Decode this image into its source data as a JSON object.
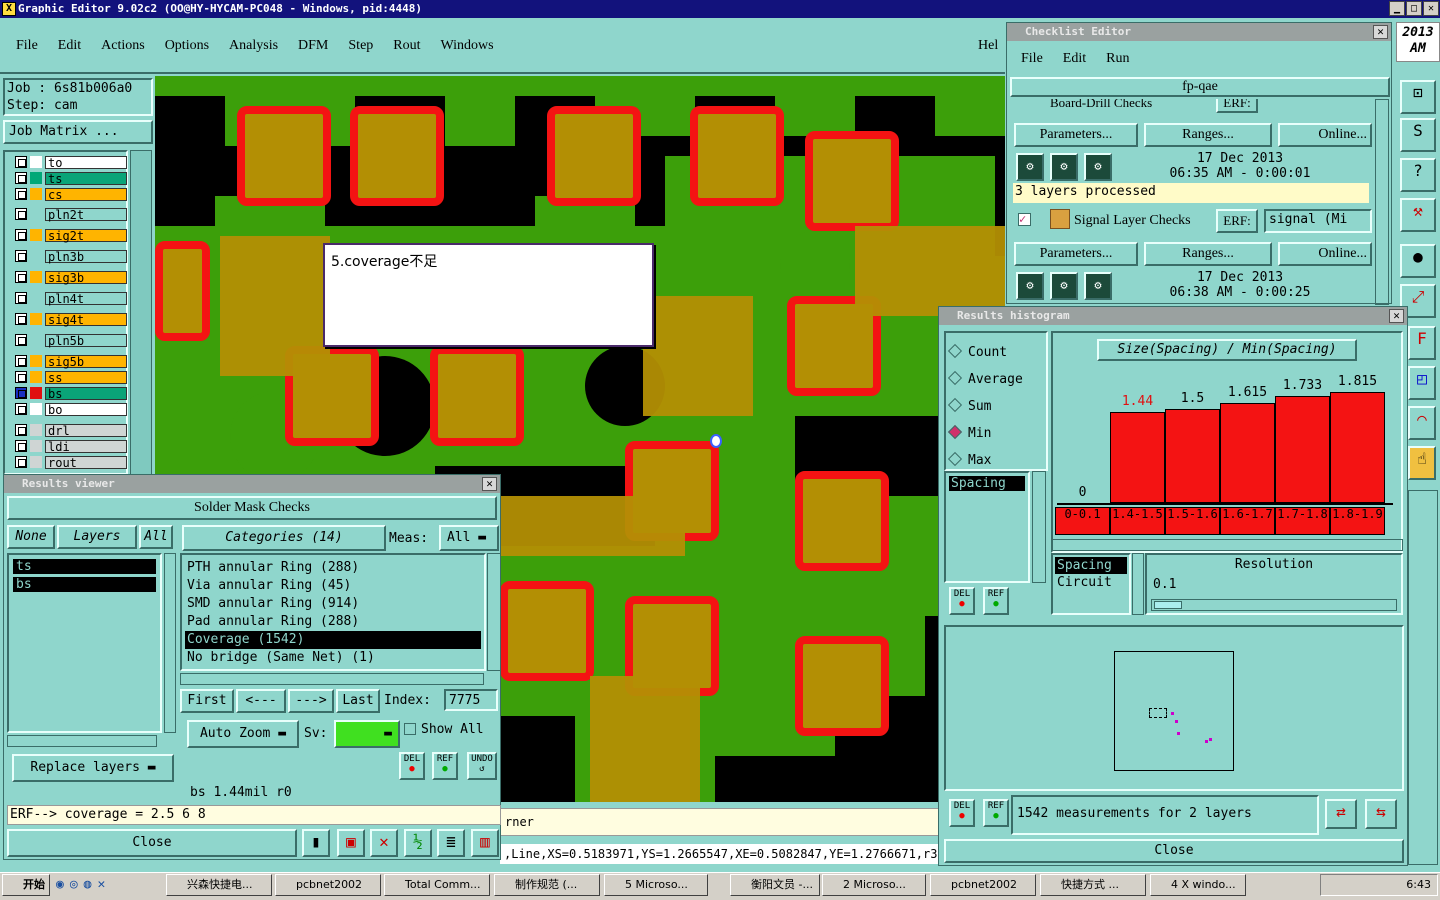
{
  "app": {
    "title": "Graphic Editor 9.02c2 (OO@HY-HYCAM-PC048 - Windows, pid:4448)",
    "year": "2013",
    "ampm": "AM"
  },
  "menu": [
    "File",
    "Edit",
    "Actions",
    "Options",
    "Analysis",
    "DFM",
    "Step",
    "Rout",
    "Windows"
  ],
  "menu_help": "Hel",
  "job": {
    "job": "Job  : 6s81b006a0",
    "step": "Step: cam",
    "matrix_button": "Job Matrix ..."
  },
  "layers": [
    {
      "name": "to",
      "color": "#ffffff",
      "fill": "#ffffff"
    },
    {
      "name": "ts",
      "color": "#00a878",
      "fill": "#0aa478"
    },
    {
      "name": "cs",
      "color": "#ffb400",
      "fill": "#ffb400"
    },
    {
      "name": "pln2t",
      "color": "#8fd6cc",
      "fill": "#8fd6cc"
    },
    {
      "name": "sig2t",
      "color": "#ffb400",
      "fill": "#ffb400"
    },
    {
      "name": "pln3b",
      "color": "#8fd6cc",
      "fill": "#8fd6cc"
    },
    {
      "name": "sig3b",
      "color": "#ffb400",
      "fill": "#ffb400"
    },
    {
      "name": "pln4t",
      "color": "#8fd6cc",
      "fill": "#8fd6cc"
    },
    {
      "name": "sig4t",
      "color": "#ffb400",
      "fill": "#ffb400"
    },
    {
      "name": "pln5b",
      "color": "#8fd6cc",
      "fill": "#8fd6cc"
    },
    {
      "name": "sig5b",
      "color": "#ffb400",
      "fill": "#ffb400"
    },
    {
      "name": "ss",
      "color": "#ffb400",
      "fill": "#ffb400"
    },
    {
      "name": "bs",
      "color": "#0aa478",
      "fill": "#0aa478"
    },
    {
      "name": "bo",
      "color": "#ffffff",
      "fill": "#ffffff"
    },
    {
      "name": "drl",
      "color": "#cfd5d4",
      "fill": "#cfd5d4"
    },
    {
      "name": "ldi",
      "color": "#cfd5d4",
      "fill": "#cfd5d4"
    },
    {
      "name": "rout",
      "color": "#cfd5d4",
      "fill": "#cfd5d4"
    }
  ],
  "note": "5.coverage不足",
  "status_left": "rner",
  "coords": ",Line,XS=0.5183971,YS=1.2665547,XE=0.5082847,YE=1.2766671,r3.4",
  "results_viewer": {
    "title": "Results viewer",
    "header": "Solder Mask Checks",
    "none": "None",
    "layers_label": "Layers",
    "all": "All",
    "layer_list": [
      "ts",
      "bs"
    ],
    "categories_label": "Categories (14)",
    "meas_label": "Meas:",
    "meas_value": "All",
    "categories": [
      "PTH annular Ring (288)",
      "Via annular Ring (45)",
      "SMD annular Ring (914)",
      "Pad annular Ring (288)",
      "Coverage (1542)",
      "No bridge (Same Net) (1)"
    ],
    "first": "First",
    "prev": "<---",
    "next": "--->",
    "last": "Last",
    "index_label": "Index:",
    "index_value": "7775",
    "auto_zoom": "Auto Zoom",
    "sv_label": "Sv:",
    "show_all": "Show All",
    "replace_layers": "Replace layers",
    "del": "DEL",
    "ref": "REF",
    "undo": "UNDO",
    "status": "bs 1.44mil  r0",
    "erf": "ERF--> coverage = 2.5 6 8",
    "close": "Close"
  },
  "checklist": {
    "title": "Checklist Editor",
    "menu": [
      "File",
      "Edit",
      "Run"
    ],
    "name": "fp-qae",
    "check1": {
      "name": "Board-Drill Checks",
      "erf": "ERF:",
      "params": "Parameters...",
      "ranges": "Ranges...",
      "online": "Online...",
      "date": "17 Dec 2013",
      "time": "06:35 AM - 0:00:01",
      "status": "3 layers processed"
    },
    "check2": {
      "name": "Signal Layer Checks",
      "erf": "ERF:",
      "erf_value": "signal (Mi",
      "params": "Parameters...",
      "ranges": "Ranges...",
      "online": "Online...",
      "date": "17 Dec 2013",
      "time": "06:38 AM - 0:00:25"
    }
  },
  "histogram": {
    "title": "Results histogram",
    "options": [
      "Count",
      "Average",
      "Sum",
      "Min",
      "Max"
    ],
    "selected": "Min",
    "list_item": "Spacing",
    "heading": "Size(Spacing) / Min(Spacing)",
    "list2": [
      "Spacing",
      "Circuit"
    ],
    "resolution_label": "Resolution",
    "resolution_value": "0.1",
    "measurements": "1542 measurements for 2 layers",
    "close": "Close",
    "del": "DEL",
    "ref": "REF"
  },
  "chart_data": {
    "type": "bar",
    "title": "Size(Spacing) / Min(Spacing)",
    "categories": [
      "0-0.1",
      "1.4-1.5",
      "1.5-1.6",
      "1.6-1.7",
      "1.7-1.8",
      "1.8-1.9"
    ],
    "values": [
      0,
      1.44,
      1.5,
      1.615,
      1.733,
      1.815
    ],
    "labels": [
      "0",
      "1.44",
      "1.5",
      "1.615",
      "1.733",
      "1.815"
    ],
    "ylim": [
      0,
      1.815
    ]
  },
  "taskbar": {
    "start": "开始",
    "items": [
      "兴森快捷电...",
      "pcbnet2002",
      "Total Comm...",
      "制作规范 (...",
      "5 Microso...",
      "衡阳文员 -...",
      "2 Microso...",
      "pcbnet2002",
      "快捷方式 ...",
      "4 X windo..."
    ],
    "clock": "6:43"
  }
}
